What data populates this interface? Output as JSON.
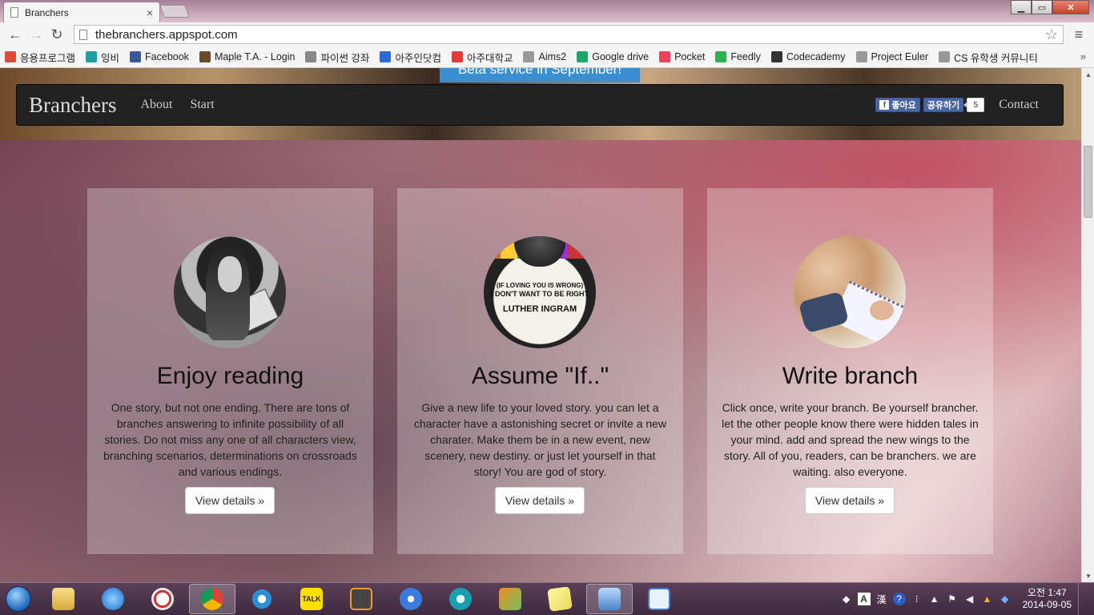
{
  "browser": {
    "tab_title": "Branchers",
    "tab_close": "×",
    "url": "thebranchers.appspot.com",
    "window_buttons": {
      "minimize": "▁",
      "maximize": "▭",
      "close": "✕"
    },
    "nav": {
      "back": "←",
      "forward": "→",
      "reload": "↻",
      "star": "☆",
      "menu": "≡"
    }
  },
  "bookmarks": [
    {
      "label": "응용프로그램",
      "icon": "apps-grid-icon",
      "color": "#e04a3a"
    },
    {
      "label": "잉비",
      "icon": "leaf-icon",
      "color": "#1aa0a0"
    },
    {
      "label": "Facebook",
      "icon": "facebook-icon",
      "color": "#3b5998"
    },
    {
      "label": "Maple T.A. - Login",
      "icon": "maple-icon",
      "color": "#6b4a2a"
    },
    {
      "label": "파이썬 강좌",
      "icon": "page-icon",
      "color": "#888888"
    },
    {
      "label": "아주인닷컴",
      "icon": "ajouin-icon",
      "color": "#2b6cd6"
    },
    {
      "label": "아주대학교",
      "icon": "ajou-icon",
      "color": "#e33b3b"
    },
    {
      "label": "Aims2",
      "icon": "page-icon",
      "color": "#999999"
    },
    {
      "label": "Google drive",
      "icon": "drive-icon",
      "color": "#1fa463"
    },
    {
      "label": "Pocket",
      "icon": "pocket-icon",
      "color": "#ee4056"
    },
    {
      "label": "Feedly",
      "icon": "feedly-icon",
      "color": "#2bb24c"
    },
    {
      "label": "Codecademy",
      "icon": "codecademy-icon",
      "color": "#333333"
    },
    {
      "label": "Project Euler",
      "icon": "page-icon",
      "color": "#999999"
    },
    {
      "label": "CS 유학생 커뮤니티",
      "icon": "page-icon",
      "color": "#999999"
    }
  ],
  "bookmarks_more": "»",
  "site": {
    "beta_banner": "Beta service in September!",
    "brand": "Branchers",
    "nav_links": [
      "About",
      "Start"
    ],
    "fb_like": "좋아요",
    "fb_share": "공유하기",
    "fb_count": "5",
    "contact": "Contact"
  },
  "features": [
    {
      "title": "Enjoy reading",
      "text": "One story, but not one ending. There are tons of branches answering to infinite possibility of all stories. Do not miss any one of all characters view, branching scenarios, determinations on crossroads and various endings.",
      "button": "View details »"
    },
    {
      "title": "Assume \"If..\"",
      "text": "Give a new life to your loved story. you can let a character have a astonishing secret or invite a new charater. Make them be in a new event, new scenery, new destiny. or just let yourself in that story! You are god of story.",
      "button": "View details »"
    },
    {
      "title": "Write branch",
      "text": "Click once, write your branch. Be yourself brancher. let the other people know there were hidden tales in your mind. add and spread the new wings to the story. All of you, readers, can be branchers. we are waiting. also everyone.",
      "button": "View details »"
    }
  ],
  "record_label": {
    "line1": "(IF LOVING YOU IS WRONG)",
    "line2": "I DON'T WANT TO BE RIGHT",
    "line3": "LUTHER INGRAM"
  },
  "taskbar": {
    "apps": [
      "explorer",
      "itunes",
      "clock",
      "chrome",
      "ie",
      "kakaotalk",
      "sublime",
      "daum",
      "evernote",
      "matlab",
      "notes",
      "remote",
      "editor"
    ],
    "tray": {
      "ime_a": "A",
      "ime_han": "漢",
      "help": "?",
      "time": "오전 1:47",
      "date": "2014-09-05"
    }
  }
}
